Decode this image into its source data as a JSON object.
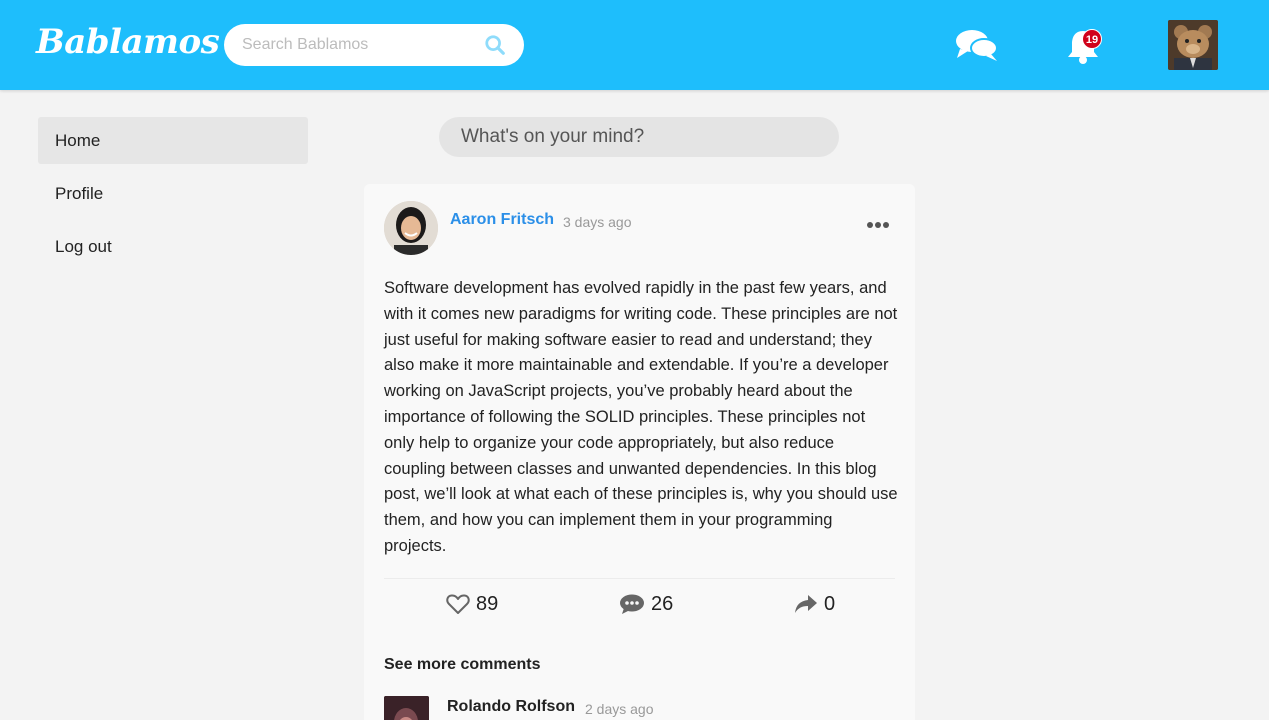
{
  "header": {
    "logo": "Bablamos",
    "search_placeholder": "Search Bablamos",
    "notification_count": "19",
    "icons": [
      "search-icon",
      "messages-icon",
      "bell-icon"
    ],
    "accent_color": "#1ebefc"
  },
  "sidebar": {
    "items": [
      {
        "label": "Home",
        "active": true
      },
      {
        "label": "Profile",
        "active": false
      },
      {
        "label": "Log out",
        "active": false
      }
    ]
  },
  "composer": {
    "placeholder": "What's on your mind?"
  },
  "post": {
    "author": "Aaron Fritsch",
    "time": "3 days ago",
    "body": "Software development has evolved rapidly in the past few years, and with it comes new paradigms for writing code. These principles are not just useful for making software easier to read and understand; they also make it more maintainable and extendable. If you’re a developer working on JavaScript projects, you’ve probably heard about the importance of following the SOLID principles. These principles not only help to organize your code appropriately, but also reduce coupling between classes and unwanted dependencies. In this blog post, we’ll look at what each of these principles is, why you should use them, and how you can implement them in your programming projects.",
    "likes": "89",
    "comments": "26",
    "shares": "0",
    "see_more_label": "See more comments"
  },
  "comment": {
    "author": "Rolando Rolfson",
    "time": "2 days ago"
  }
}
